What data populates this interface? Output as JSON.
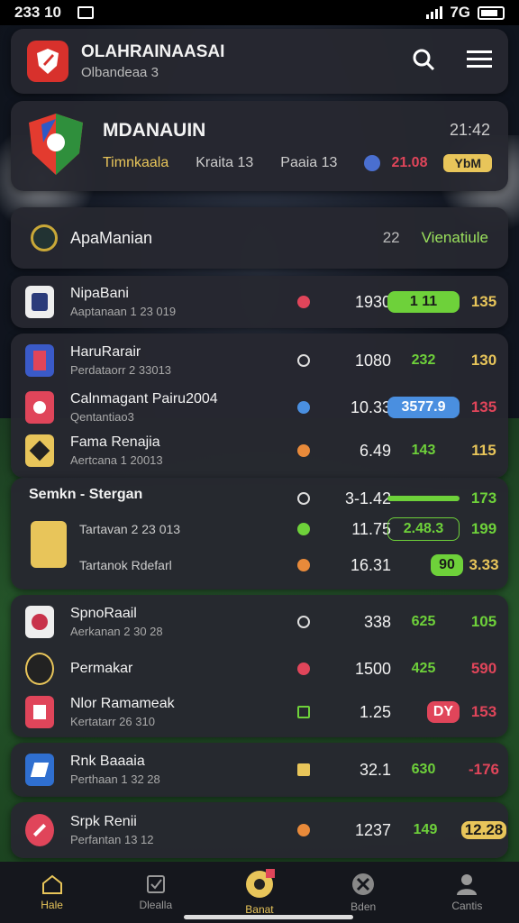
{
  "status": {
    "time": "233 10",
    "network": "7G"
  },
  "header": {
    "title": "OLAHRAINAASAI",
    "subtitle": "Olbandeaa 3"
  },
  "match": {
    "name": "MDANAUIN",
    "time": "21:42",
    "col1": "Timnkaala",
    "col2": "Kraita 13",
    "col3": "Paaia 13",
    "score": "21.08",
    "tag": "YbM"
  },
  "section": {
    "label": "ApaManian",
    "count": "22",
    "link": "Vienatiule"
  },
  "groups": [
    {
      "items": [
        {
          "name": "NipaBani",
          "sub": "Aaptanaan 1 23 019",
          "val": "1930",
          "odd": "1 11",
          "last": "135"
        }
      ]
    },
    {
      "items": [
        {
          "name": "HaruRarair",
          "sub": "Perdataorr 2 33013",
          "val": "1080",
          "odd": "232",
          "last": "130"
        },
        {
          "name": "Calnmagant Pairu2004",
          "sub": "Qentantiao3",
          "val": "10.33",
          "odd": "3577.9",
          "last": "135"
        },
        {
          "name": "Fama Renajia",
          "sub": "Aertcana 1 20013",
          "val": "6.49",
          "odd": "143",
          "last": "115"
        }
      ]
    },
    {
      "title": "Semkn - Stergan",
      "items": [
        {
          "name": "",
          "sub": "",
          "val": "3-1.42",
          "odd": "",
          "last": "173"
        },
        {
          "name": "Tartavan 2 23 013",
          "sub": "",
          "val": "11.75",
          "odd": "2.48.3",
          "last": "199"
        },
        {
          "name": "Tartanok Rdefarl",
          "sub": "",
          "val": "16.31",
          "odd": "90",
          "last": "3.33"
        }
      ]
    },
    {
      "items": [
        {
          "name": "SpnoRaail",
          "sub": "Aerkanan 2 30 28",
          "val": "338",
          "odd": "625",
          "last": "105"
        },
        {
          "name": "Permakar",
          "sub": "",
          "val": "1500",
          "odd": "425",
          "last": "590"
        },
        {
          "name": "Nlor Ramameak",
          "sub": "Kertatarr 26 310",
          "val": "1.25",
          "odd": "DY",
          "last": "153"
        }
      ]
    },
    {
      "items": [
        {
          "name": "Rnk Baaaia",
          "sub": "Perthaan 1 32 28",
          "val": "32.1",
          "odd": "630",
          "last": "-176"
        }
      ]
    },
    {
      "items": [
        {
          "name": "Srpk Renii",
          "sub": "Perfantan 13 12",
          "val": "1237",
          "odd": "149",
          "last": "12.28"
        }
      ]
    }
  ],
  "nav": [
    {
      "label": "Hale",
      "icon": "home-icon"
    },
    {
      "label": "Dlealla",
      "icon": "ticket-icon"
    },
    {
      "label": "Banat",
      "icon": "ball-icon"
    },
    {
      "label": "Bden",
      "icon": "soccer-icon"
    },
    {
      "label": "Cantis",
      "icon": "user-icon"
    }
  ],
  "colors": {
    "accent": "#e8c55a",
    "green": "#6ed13a",
    "blue": "#4a8fe0",
    "red": "#e0455a"
  }
}
